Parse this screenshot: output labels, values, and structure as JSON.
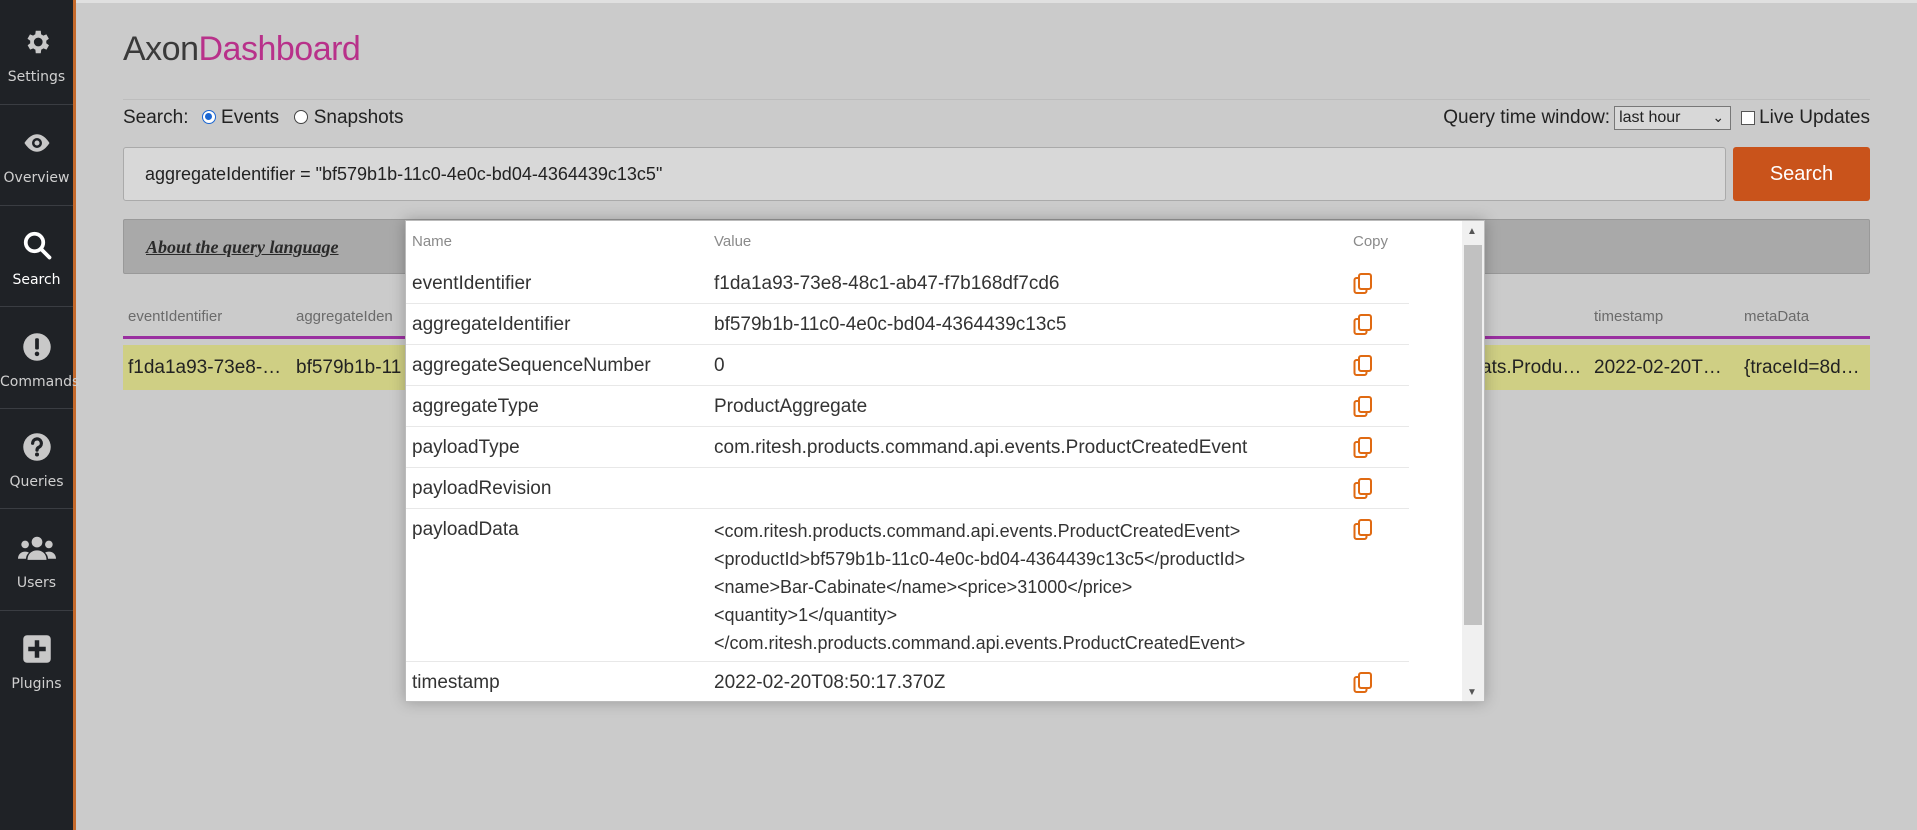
{
  "sidebar": {
    "items": [
      {
        "label": "Settings",
        "icon": "gear-icon"
      },
      {
        "label": "Overview",
        "icon": "eye-icon"
      },
      {
        "label": "Search",
        "icon": "search-icon"
      },
      {
        "label": "Commands",
        "icon": "exclamation-circle-icon"
      },
      {
        "label": "Queries",
        "icon": "question-circle-icon"
      },
      {
        "label": "Users",
        "icon": "users-icon"
      },
      {
        "label": "Plugins",
        "icon": "plus-square-icon"
      }
    ]
  },
  "header": {
    "logo_part1": "Axon",
    "logo_part2": "Dashboard"
  },
  "search_options": {
    "label": "Search:",
    "events_label": "Events",
    "snapshots_label": "Snapshots",
    "selected": "Events"
  },
  "time_window": {
    "label": "Query time window:",
    "selected": "last hour",
    "live_updates_label": "Live Updates"
  },
  "query": {
    "value": "aggregateIdentifier = \"bf579b1b-11c0-4e0c-bd04-4364439c13c5\""
  },
  "search_button_label": "Search",
  "about_link": "About the query language",
  "result_table": {
    "columns": [
      "eventIdentifier",
      "aggregateIden",
      "timestamp",
      "metaData"
    ],
    "row": {
      "eventIdentifier": "f1da1a93-73e8-…",
      "aggregateIdentifier": "bf579b1b-11",
      "payloadType": "ats.Produ…",
      "timestamp": "2022-02-20T…",
      "metaData": "{traceId=8d…"
    }
  },
  "details": {
    "headers": {
      "name": "Name",
      "value": "Value",
      "copy": "Copy"
    },
    "rows": [
      {
        "name": "eventIdentifier",
        "value": "f1da1a93-73e8-48c1-ab47-f7b168df7cd6"
      },
      {
        "name": "aggregateIdentifier",
        "value": "bf579b1b-11c0-4e0c-bd04-4364439c13c5"
      },
      {
        "name": "aggregateSequenceNumber",
        "value": "0"
      },
      {
        "name": "aggregateType",
        "value": "ProductAggregate"
      },
      {
        "name": "payloadType",
        "value": "com.ritesh.products.command.api.events.ProductCreatedEvent"
      },
      {
        "name": "payloadRevision",
        "value": ""
      },
      {
        "name": "payloadData",
        "lines": [
          "<com.ritesh.products.command.api.events.ProductCreatedEvent>",
          "<productId>bf579b1b-11c0-4e0c-bd04-4364439c13c5</productId>",
          "<name>Bar-Cabinate</name><price>31000</price>",
          "<quantity>1</quantity>",
          "</com.ritesh.products.command.api.events.ProductCreatedEvent>"
        ]
      },
      {
        "name": "timestamp",
        "value": "2022-02-20T08:50:17.370Z"
      }
    ]
  },
  "colors": {
    "sidebar_bg": "#1f2226",
    "accent_orange": "#c9531b",
    "logo_magenta": "#b8318a",
    "table_underline": "#9a2fa0",
    "row_highlight": "#cfcf84",
    "copy_icon": "#e06a12"
  }
}
